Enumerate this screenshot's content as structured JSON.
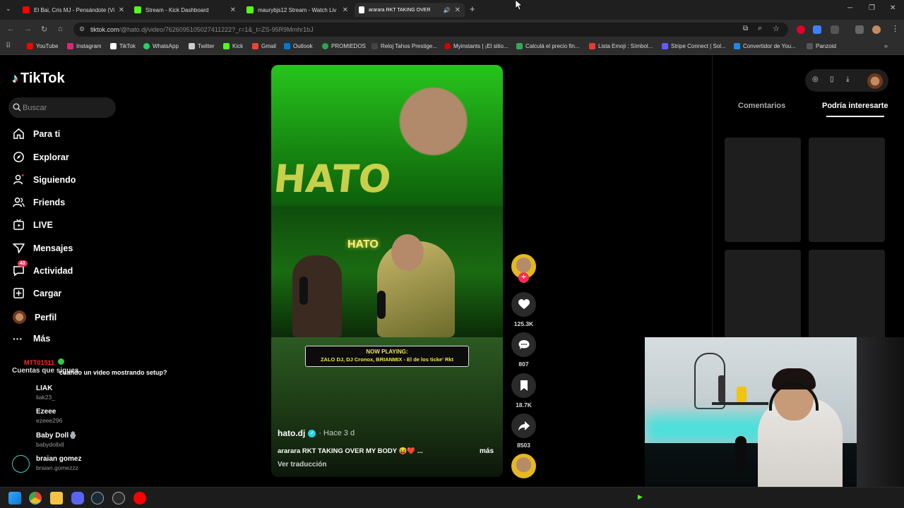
{
  "tabs": [
    {
      "title": "El Bai, Cris MJ - Pensándote (Vi",
      "color": "#ff0000"
    },
    {
      "title": "Stream - Kick Dashboard",
      "color": "#53fc18"
    },
    {
      "title": "maurybjs12 Stream - Watch Liv",
      "color": "#53fc18"
    },
    {
      "title": "ararara RKT TAKING OVER",
      "color": "#ffffff"
    }
  ],
  "address": {
    "host": "tiktok.com",
    "path": "/@hato.dj/video/7626095105027411222?_r=1&_t=ZS-95R9Mmhr1bJ"
  },
  "bookmarks": [
    {
      "label": "YouTube",
      "color": "#ff0000"
    },
    {
      "label": "Instagram",
      "color": "#d62976"
    },
    {
      "label": "TikTok",
      "color": "#ffffff"
    },
    {
      "label": "WhatsApp",
      "color": "#25d366"
    },
    {
      "label": "Twitter",
      "color": "#cccccc"
    },
    {
      "label": "Kick",
      "color": "#53fc18"
    },
    {
      "label": "Gmail",
      "color": "#ea4335"
    },
    {
      "label": "Outlook",
      "color": "#0078d4"
    },
    {
      "label": "PROMIEDOS",
      "color": "#2ea44f"
    },
    {
      "label": "Reloj Tahos Prestige...",
      "color": "#444444"
    },
    {
      "label": "Myinstants | ¡El sitio...",
      "color": "#d40000"
    },
    {
      "label": "Calculá el precio fin...",
      "color": "#34a853"
    },
    {
      "label": "Lista Emoji : Símbol...",
      "color": "#e53935"
    },
    {
      "label": "Stripe Connect | Sol...",
      "color": "#635bff"
    },
    {
      "label": "Convertidor de You...",
      "color": "#1e88e5"
    },
    {
      "label": "Panzoid",
      "color": "#555555"
    }
  ],
  "tiktok": {
    "logo": "TikTok",
    "search_placeholder": "Buscar",
    "nav": [
      {
        "label": "Para ti",
        "icon": "home-icon"
      },
      {
        "label": "Explorar",
        "icon": "compass-icon"
      },
      {
        "label": "Siguiendo",
        "icon": "following-icon"
      },
      {
        "label": "Friends",
        "icon": "friends-icon"
      },
      {
        "label": "LIVE",
        "icon": "live-icon"
      },
      {
        "label": "Mensajes",
        "icon": "send-icon"
      },
      {
        "label": "Actividad",
        "icon": "activity-icon",
        "badge": "43"
      },
      {
        "label": "Cargar",
        "icon": "upload-icon"
      },
      {
        "label": "Perfil",
        "icon": "avatar"
      },
      {
        "label": "Más",
        "icon": "more-icon"
      }
    ],
    "following_title": "Cuentas que sigues",
    "accounts": [
      {
        "name": "LIAK",
        "user": "liak23_"
      },
      {
        "name": "Ezeee",
        "user": "ezeee296"
      },
      {
        "name": "Baby Doll🪬",
        "user": "babydollxll"
      },
      {
        "name": "braian gomez",
        "user": "braian.gomezzz"
      }
    ],
    "chat_user": "MTT01511",
    "chat_msg": "cuando un video mostrando setup?",
    "video": {
      "now_playing_title": "NOW PLAYING:",
      "now_playing_song": "ZALO DJ, DJ Cronox, BRIANMIX - El de los ticke' Rkt",
      "sign": "HATO",
      "author": "hato.dj",
      "time": "· Hace 3 d",
      "caption": "ararara RKT TAKING OVER MY BODY 😝❤️ ...",
      "more": "más",
      "translate": "Ver traducción"
    },
    "actions": {
      "likes": "125.3K",
      "comments": "807",
      "saves": "18.7K",
      "shares": "8503"
    },
    "right_tabs": [
      "Comentarios",
      "Podría interesarte"
    ]
  }
}
